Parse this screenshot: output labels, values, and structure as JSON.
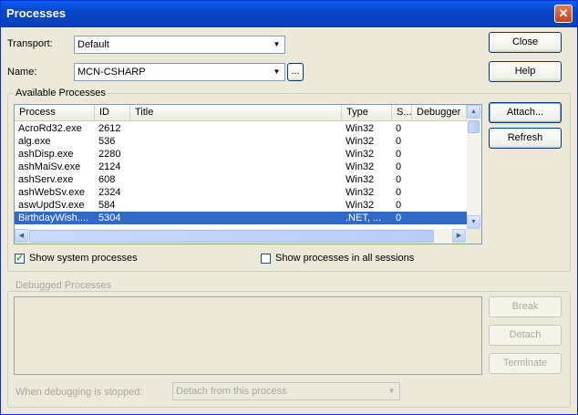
{
  "window": {
    "title": "Processes",
    "close_glyph": "✕"
  },
  "transport": {
    "label": "Transport:",
    "value": "Default"
  },
  "name": {
    "label": "Name:",
    "value": "MCN-CSHARP",
    "browse_label": "..."
  },
  "buttons": {
    "close": "Close",
    "help": "Help",
    "attach": "Attach...",
    "refresh": "Refresh",
    "break": "Break",
    "detach": "Detach",
    "terminate": "Terminate"
  },
  "available": {
    "title": "Available Processes",
    "columns": [
      "Process",
      "ID",
      "Title",
      "Type",
      "S...",
      "Debugger"
    ],
    "rows": [
      {
        "process": "AcroRd32.exe",
        "id": "2612",
        "title": "",
        "type": "Win32",
        "session": "0",
        "debugger": ""
      },
      {
        "process": "alg.exe",
        "id": "536",
        "title": "",
        "type": "Win32",
        "session": "0",
        "debugger": ""
      },
      {
        "process": "ashDisp.exe",
        "id": "2280",
        "title": "",
        "type": "Win32",
        "session": "0",
        "debugger": ""
      },
      {
        "process": "ashMaiSv.exe",
        "id": "2124",
        "title": "",
        "type": "Win32",
        "session": "0",
        "debugger": ""
      },
      {
        "process": "ashServ.exe",
        "id": "608",
        "title": "",
        "type": "Win32",
        "session": "0",
        "debugger": ""
      },
      {
        "process": "ashWebSv.exe",
        "id": "2324",
        "title": "",
        "type": "Win32",
        "session": "0",
        "debugger": ""
      },
      {
        "process": "aswUpdSv.exe",
        "id": "584",
        "title": "",
        "type": "Win32",
        "session": "0",
        "debugger": ""
      },
      {
        "process": "BirthdayWish....",
        "id": "5304",
        "title": "",
        "type": ".NET, ...",
        "session": "0",
        "debugger": "",
        "selected": true
      }
    ],
    "show_system": {
      "label": "Show system processes",
      "checked": true
    },
    "show_all_sessions": {
      "label": "Show processes in all sessions",
      "checked": false
    }
  },
  "debugged": {
    "title": "Debugged Processes",
    "when_stopped_label": "When debugging is stopped:",
    "when_stopped_value": "Detach from this process"
  }
}
